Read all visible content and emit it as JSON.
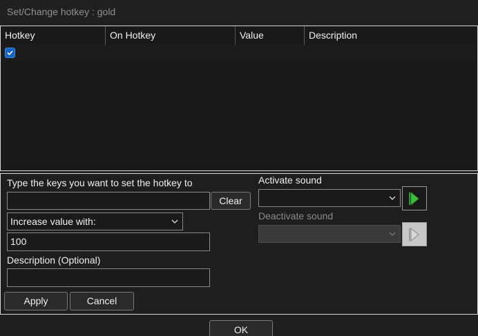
{
  "window": {
    "title": "Set/Change hotkey : gold"
  },
  "list": {
    "columns": [
      "Hotkey",
      "On Hotkey",
      "Value",
      "Description"
    ],
    "rows": [
      {
        "checked": true,
        "on_hotkey": "",
        "value": "",
        "description": ""
      }
    ]
  },
  "editor": {
    "keys_label": "Type the keys you want to set the hotkey to",
    "keys_value": "",
    "clear_label": "Clear",
    "action_selected": "Increase value with:",
    "value": "100",
    "description_label": "Description (Optional)",
    "description_value": "",
    "apply_label": "Apply",
    "cancel_label": "Cancel",
    "activate_sound_label": "Activate sound",
    "activate_sound_value": "",
    "deactivate_sound_label": "Deactivate sound",
    "deactivate_sound_value": ""
  },
  "footer": {
    "ok_label": "OK"
  },
  "colors": {
    "accent": "#1565c0",
    "play_green": "#3cc13c",
    "background": "#1f1f1f"
  },
  "icons": {
    "checkbox": "check-icon",
    "dropdown": "chevron-down-icon",
    "play": "play-icon"
  }
}
